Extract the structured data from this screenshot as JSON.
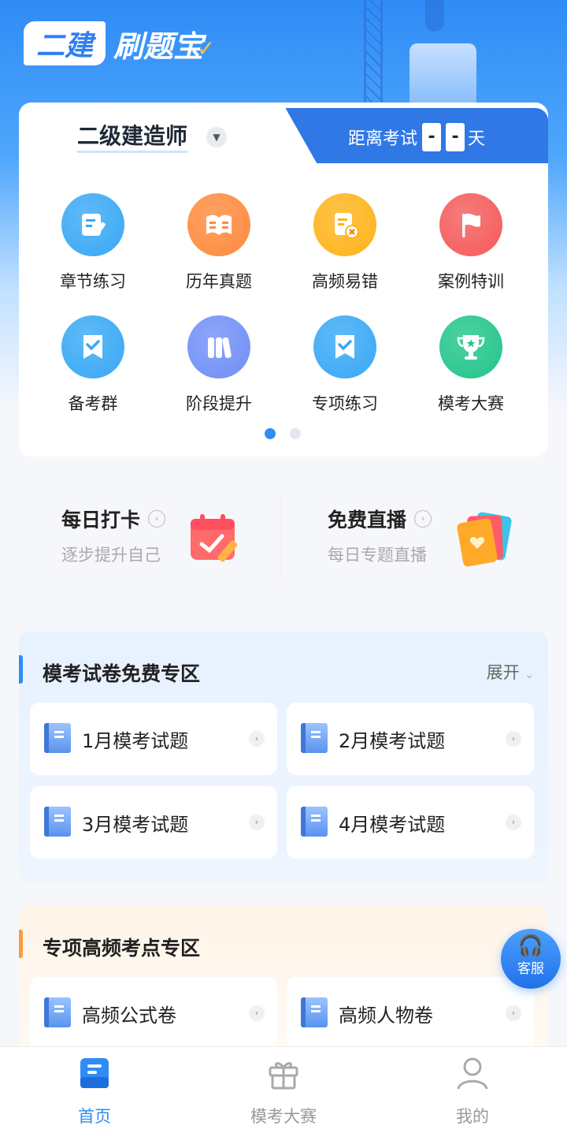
{
  "header": {
    "logo_badge": "二建",
    "logo_text": "刷题宝",
    "logo_check": "✓"
  },
  "exam": {
    "name": "二级建造师",
    "countdown_label": "距离考试",
    "digit1": "-",
    "digit2": "-",
    "unit": "天"
  },
  "grid": [
    {
      "label": "章节练习",
      "icon": "edit-icon",
      "color": "#38a8f5"
    },
    {
      "label": "历年真题",
      "icon": "book-icon",
      "color": "#ff8a3d"
    },
    {
      "label": "高频易错",
      "icon": "error-doc-icon",
      "color": "#ffb319"
    },
    {
      "label": "案例特训",
      "icon": "flag-icon",
      "color": "#f55a5a"
    },
    {
      "label": "备考群",
      "icon": "bookmark-check-icon",
      "color": "#38a8f5"
    },
    {
      "label": "阶段提升",
      "icon": "books-icon",
      "color": "#6f8ff7"
    },
    {
      "label": "专项练习",
      "icon": "bookmark-check-icon",
      "color": "#38a8f5"
    },
    {
      "label": "模考大赛",
      "icon": "trophy-icon",
      "color": "#22c58b"
    }
  ],
  "pager": {
    "pages": 2,
    "active": 0
  },
  "quick": [
    {
      "title": "每日打卡",
      "subtitle": "逐步提升自己",
      "icon": "calendar-check-icon"
    },
    {
      "title": "免费直播",
      "subtitle": "每日专题直播",
      "icon": "cards-icon"
    }
  ],
  "mock_section": {
    "title": "模考试卷免费专区",
    "expand": "展开",
    "accent": "#2f8cf6",
    "papers": [
      "1月模考试题",
      "2月模考试题",
      "3月模考试题",
      "4月模考试题"
    ]
  },
  "special_section": {
    "title": "专项高频考点专区",
    "accent": "#ff9a3c",
    "papers": [
      "高频公式卷",
      "高频人物卷"
    ]
  },
  "service": {
    "label": "客服",
    "icon": "headset-icon"
  },
  "tabbar": [
    {
      "label": "首页",
      "icon": "home-icon",
      "active": true
    },
    {
      "label": "模考大赛",
      "icon": "gift-icon",
      "active": false
    },
    {
      "label": "我的",
      "icon": "user-icon",
      "active": false
    }
  ]
}
